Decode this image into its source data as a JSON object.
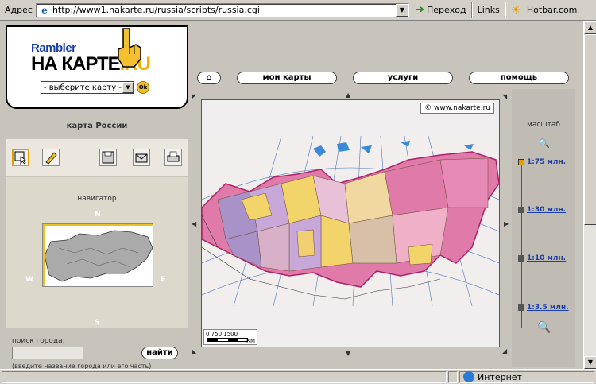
{
  "browser": {
    "address_label": "Адрес",
    "url": "http://www1.nakarte.ru/russia/scripts/russia.cgi",
    "go_label": "Переход",
    "links_label": "Links",
    "hotbar_label": "Hotbar.com",
    "status_zone": "Интернет"
  },
  "logo": {
    "rambler": "Rambler",
    "nakarte": "НА КАРТЕ",
    "ru": ".RU",
    "select_value": "- выберите карту -",
    "ok_label": "Ok"
  },
  "nav": {
    "home_icon": "home-icon",
    "items": [
      {
        "label": "мои карты"
      },
      {
        "label": "услуги"
      },
      {
        "label": "помощь"
      }
    ]
  },
  "left": {
    "title": "карта России",
    "tools": [
      "select-icon",
      "pencil-icon",
      "save-icon",
      "mail-icon",
      "print-icon"
    ],
    "navigator_title": "навигатор",
    "compass": {
      "n": "N",
      "s": "S",
      "w": "W",
      "e": "E"
    },
    "search_label": "поиск города:",
    "search_value": "",
    "find_label": "найти",
    "search_hint": "(введите название города или его часть)"
  },
  "map": {
    "copyright": "©  www.nakarte.ru",
    "scale_ticks": "0    750   1500",
    "scale_unit": "КМ"
  },
  "scale": {
    "title": "масштаб",
    "items": [
      {
        "label": "1:75 млн.",
        "selected": true
      },
      {
        "label": "1:30 млн.",
        "selected": false
      },
      {
        "label": "1:10 млн.",
        "selected": false
      },
      {
        "label": "1:3.5 млн.",
        "selected": false
      }
    ]
  },
  "colors": {
    "accent_yellow": "#f0b000",
    "link_blue": "#1b3fa8",
    "region_pink": "#e07aa8",
    "region_yellow": "#f2d46a",
    "region_purple": "#a892c8",
    "sea_blue": "#3a8ad8"
  }
}
